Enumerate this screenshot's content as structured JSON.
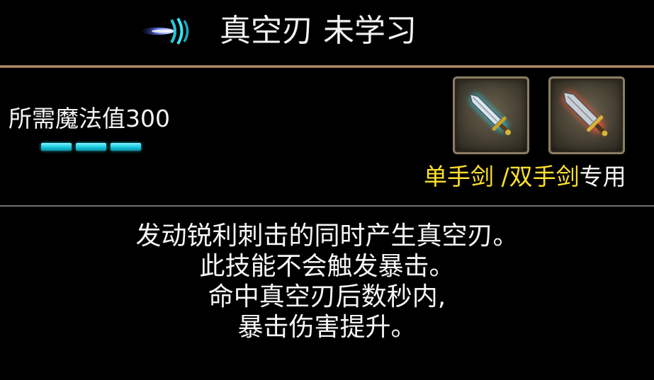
{
  "skill": {
    "icon": "wind-blade-icon",
    "name": "真空刃",
    "status": "未学习"
  },
  "mana": {
    "label": "所需魔法值300",
    "bar_icon": "mana-bar-icon",
    "bar_count": 3,
    "bar_color": "#16c9de"
  },
  "weapons": {
    "slots": [
      {
        "icon": "one-handed-sword-icon",
        "glow": "#22d8f0"
      },
      {
        "icon": "two-handed-sword-icon",
        "glow": "#ff5a3a"
      }
    ],
    "types_label": "单手剑 /双手剑",
    "suffix_label": "专用",
    "types_color": "#ffe030"
  },
  "description": {
    "lines": [
      "发动锐利刺击的同时产生真空刃。",
      "此技能不会触发暴击。",
      "命中真空刃后数秒内,",
      "暴击伤害提升。"
    ]
  }
}
